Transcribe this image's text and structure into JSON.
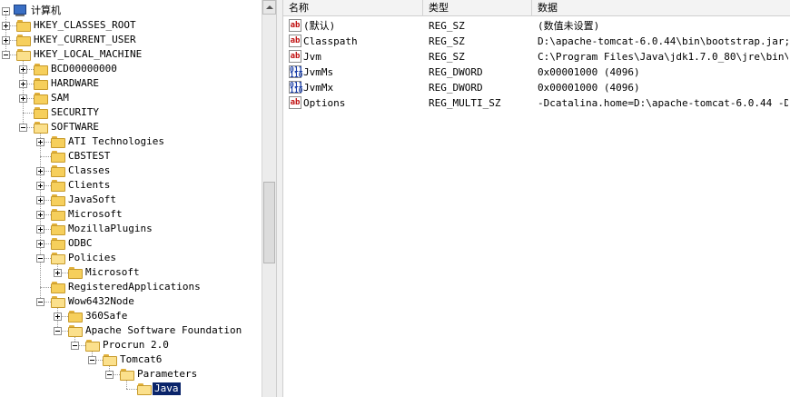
{
  "tree": {
    "root_label": "计算机",
    "nodes": [
      {
        "label": "HKEY_CLASSES_ROOT",
        "level": 1,
        "toggle": "plus"
      },
      {
        "label": "HKEY_CURRENT_USER",
        "level": 1,
        "toggle": "plus"
      },
      {
        "label": "HKEY_LOCAL_MACHINE",
        "level": 1,
        "toggle": "minus"
      },
      {
        "label": "BCD00000000",
        "level": 2,
        "toggle": "plus"
      },
      {
        "label": "HARDWARE",
        "level": 2,
        "toggle": "plus"
      },
      {
        "label": "SAM",
        "level": 2,
        "toggle": "plus"
      },
      {
        "label": "SECURITY",
        "level": 2,
        "toggle": "none"
      },
      {
        "label": "SOFTWARE",
        "level": 2,
        "toggle": "minus"
      },
      {
        "label": "ATI Technologies",
        "level": 3,
        "toggle": "plus"
      },
      {
        "label": "CBSTEST",
        "level": 3,
        "toggle": "none"
      },
      {
        "label": "Classes",
        "level": 3,
        "toggle": "plus"
      },
      {
        "label": "Clients",
        "level": 3,
        "toggle": "plus"
      },
      {
        "label": "JavaSoft",
        "level": 3,
        "toggle": "plus"
      },
      {
        "label": "Microsoft",
        "level": 3,
        "toggle": "plus"
      },
      {
        "label": "MozillaPlugins",
        "level": 3,
        "toggle": "plus"
      },
      {
        "label": "ODBC",
        "level": 3,
        "toggle": "plus"
      },
      {
        "label": "Policies",
        "level": 3,
        "toggle": "minus"
      },
      {
        "label": "Microsoft",
        "level": 4,
        "toggle": "plus"
      },
      {
        "label": "RegisteredApplications",
        "level": 3,
        "toggle": "none"
      },
      {
        "label": "Wow6432Node",
        "level": 3,
        "toggle": "minus"
      },
      {
        "label": "360Safe",
        "level": 4,
        "toggle": "plus"
      },
      {
        "label": "Apache Software Foundation",
        "level": 4,
        "toggle": "minus"
      },
      {
        "label": "Procrun 2.0",
        "level": 5,
        "toggle": "minus"
      },
      {
        "label": "Tomcat6",
        "level": 6,
        "toggle": "minus"
      },
      {
        "label": "Parameters",
        "level": 7,
        "toggle": "minus"
      },
      {
        "label": "Java",
        "level": 8,
        "toggle": "none",
        "selected": true
      }
    ]
  },
  "list": {
    "columns": {
      "name": "名称",
      "type": "类型",
      "data": "数据"
    },
    "rows": [
      {
        "icon": "string-value-icon",
        "name": "(默认)",
        "type": "REG_SZ",
        "data": "(数值未设置)"
      },
      {
        "icon": "string-value-icon",
        "name": "Classpath",
        "type": "REG_SZ",
        "data": "D:\\apache-tomcat-6.0.44\\bin\\bootstrap.jar;D..."
      },
      {
        "icon": "string-value-icon",
        "name": "Jvm",
        "type": "REG_SZ",
        "data": "C:\\Program Files\\Java\\jdk1.7.0_80\\jre\\bin\\s..."
      },
      {
        "icon": "dword-value-icon",
        "name": "JvmMs",
        "type": "REG_DWORD",
        "data": "0x00001000 (4096)"
      },
      {
        "icon": "dword-value-icon",
        "name": "JvmMx",
        "type": "REG_DWORD",
        "data": "0x00001000 (4096)"
      },
      {
        "icon": "string-value-icon",
        "name": "Options",
        "type": "REG_MULTI_SZ",
        "data": "-Dcatalina.home=D:\\apache-tomcat-6.0.44 -Dc..."
      }
    ]
  },
  "colors": {
    "selection": "#0a246a",
    "folder": "#f6cf5c",
    "string_icon": "#c01010",
    "dword_icon": "#1a3ea8"
  }
}
